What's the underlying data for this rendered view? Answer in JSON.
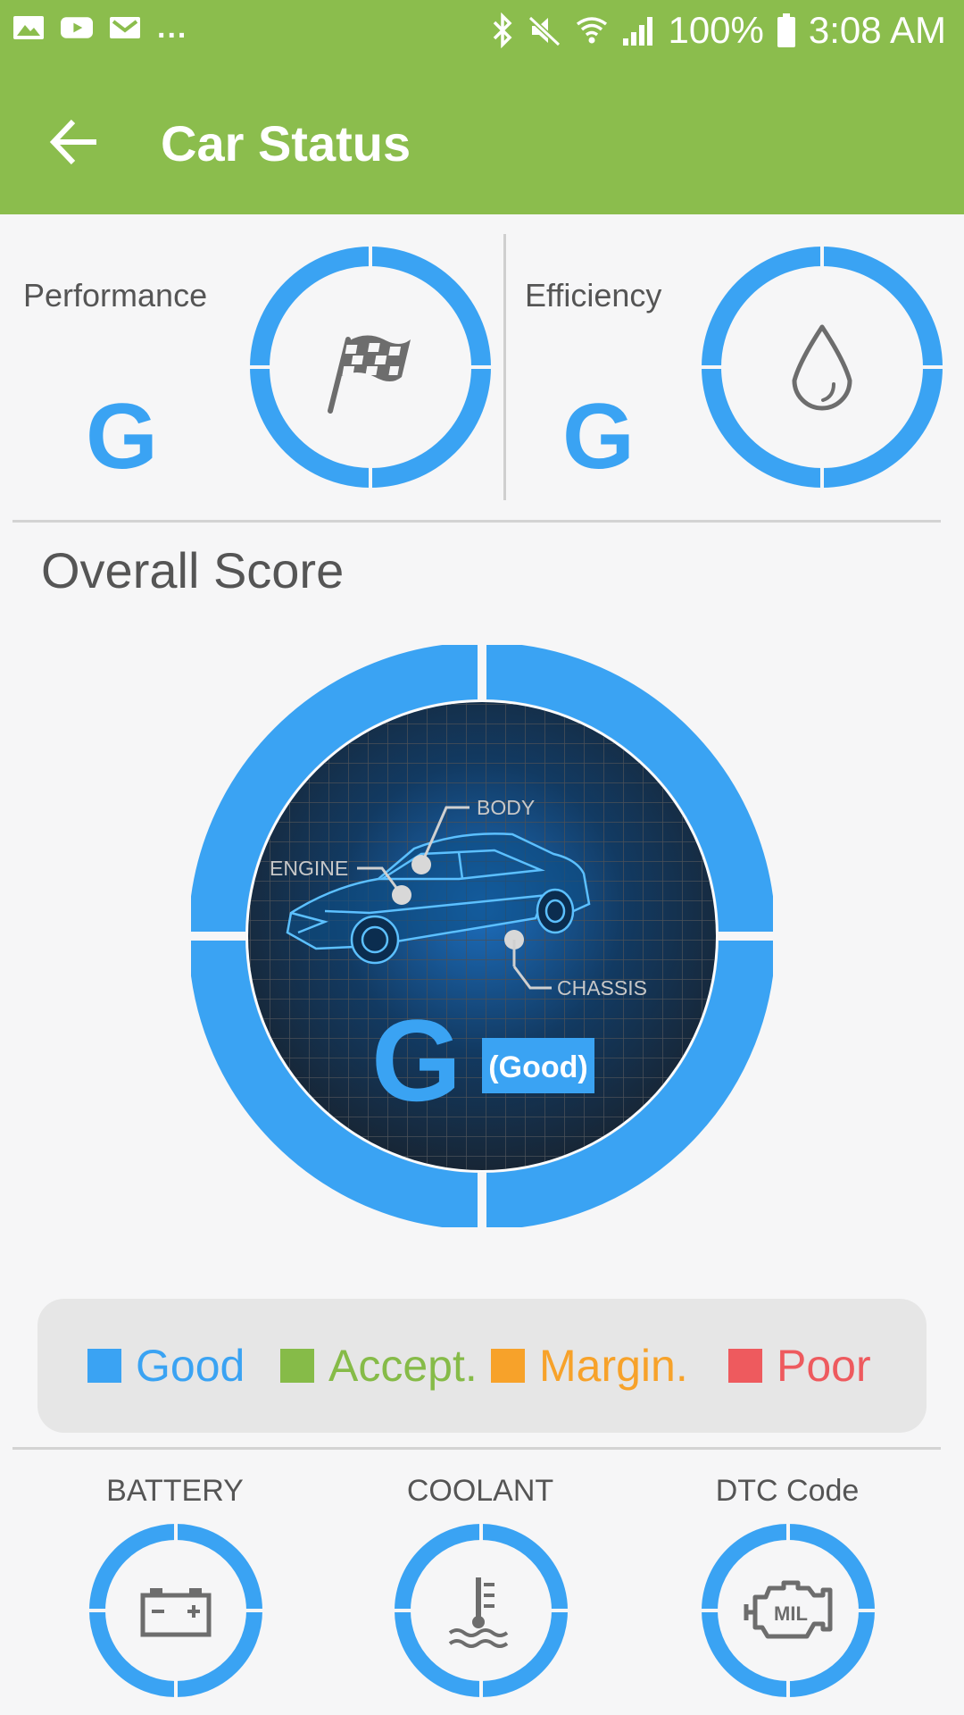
{
  "status_bar": {
    "left_icons": [
      "image-icon",
      "youtube-icon",
      "gmail-icon"
    ],
    "more": "...",
    "battery_text": "100%",
    "time": "3:08 AM"
  },
  "app_bar": {
    "title": "Car Status",
    "back_icon": "arrow-left-icon"
  },
  "performance": {
    "label": "Performance",
    "grade": "G",
    "icon": "checkered-flag-icon"
  },
  "efficiency": {
    "label": "Efficiency",
    "grade": "G",
    "icon": "water-drop-icon"
  },
  "overall": {
    "title": "Overall Score",
    "grade": "G",
    "grade_text": "(Good)",
    "callouts": {
      "engine": "ENGINE",
      "body": "BODY",
      "chassis": "CHASSIS"
    }
  },
  "legend": [
    {
      "label": "Good",
      "color": "#3aa3f3"
    },
    {
      "label": "Accept.",
      "color": "#86bb48"
    },
    {
      "label": "Margin.",
      "color": "#f7a22a"
    },
    {
      "label": "Poor",
      "color": "#ee5a5e"
    }
  ],
  "bottom": [
    {
      "label": "BATTERY",
      "icon": "battery-icon"
    },
    {
      "label": "COOLANT",
      "icon": "coolant-temperature-icon"
    },
    {
      "label": "DTC Code",
      "icon": "engine-mil-icon"
    }
  ],
  "colors": {
    "appbar": "#8bbd4d",
    "accent": "#3aa3f3"
  }
}
